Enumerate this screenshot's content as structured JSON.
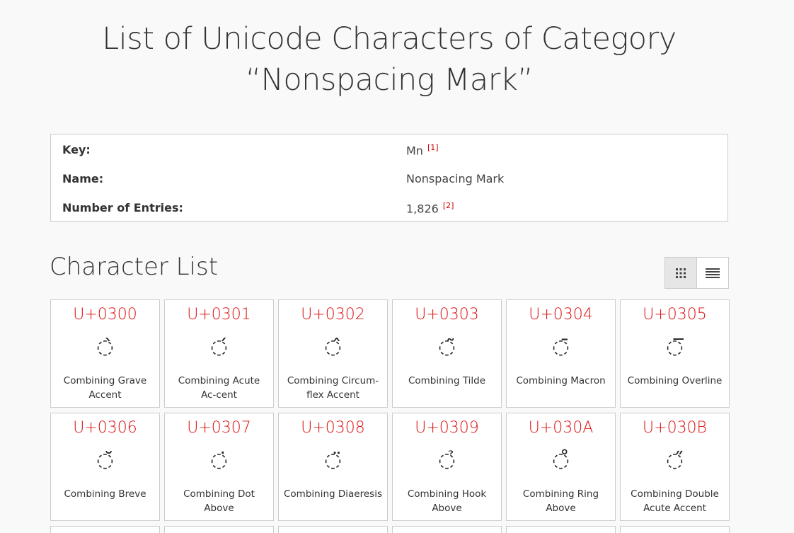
{
  "page": {
    "title_line1": "List of Unicode Characters of Category",
    "title_line2": "“Nonspacing Mark”"
  },
  "info": {
    "key_label": "Key:",
    "key_value": "Mn",
    "key_ref": "[1]",
    "name_label": "Name:",
    "name_value": "Nonspacing Mark",
    "entries_label": "Number of Entries:",
    "entries_value": "1,826",
    "entries_ref": "[2]"
  },
  "section": {
    "title": "Character List",
    "view_grid": "grid-view-icon",
    "view_list": "list-view-icon"
  },
  "characters": [
    {
      "code": "U+0300",
      "glyph": "◌̀",
      "name": "Combining Grave Accent"
    },
    {
      "code": "U+0301",
      "glyph": "◌́",
      "name": "Combining Acute Ac-cent"
    },
    {
      "code": "U+0302",
      "glyph": "◌̂",
      "name": "Combining Circum-flex Accent"
    },
    {
      "code": "U+0303",
      "glyph": "◌̃",
      "name": "Combining Tilde"
    },
    {
      "code": "U+0304",
      "glyph": "◌̄",
      "name": "Combining Macron"
    },
    {
      "code": "U+0305",
      "glyph": "◌̅",
      "name": "Combining Overline"
    },
    {
      "code": "U+0306",
      "glyph": "◌̆",
      "name": "Combining Breve"
    },
    {
      "code": "U+0307",
      "glyph": "◌̇",
      "name": "Combining Dot Above"
    },
    {
      "code": "U+0308",
      "glyph": "◌̈",
      "name": "Combining Diaeresis"
    },
    {
      "code": "U+0309",
      "glyph": "◌̉",
      "name": "Combining Hook Above"
    },
    {
      "code": "U+030A",
      "glyph": "◌̊",
      "name": "Combining Ring Above"
    },
    {
      "code": "U+030B",
      "glyph": "◌̋",
      "name": "Combining Double Acute Accent"
    }
  ]
}
